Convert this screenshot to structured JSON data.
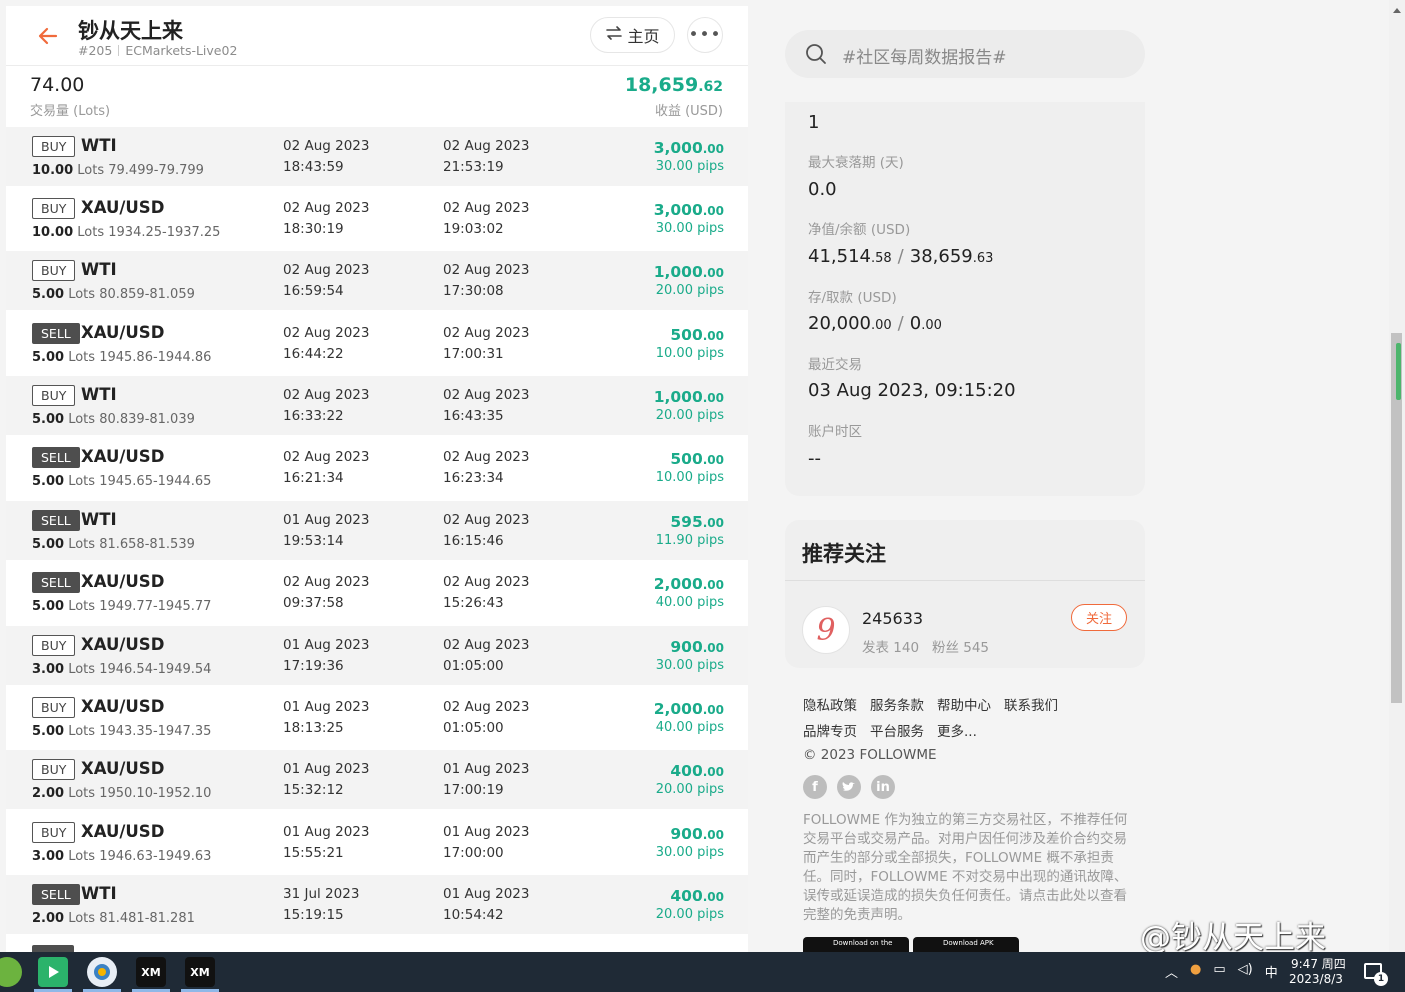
{
  "header": {
    "title": "钞从天上来",
    "rank": "#205",
    "account": "ECMarkets-Live02",
    "home_label": "主页",
    "more_label": "•••"
  },
  "summary": {
    "lots_value": "74.00",
    "lots_label": "交易量 (Lots)",
    "profit_int": "18,659",
    "profit_dec": ".62",
    "profit_label": "收益 (USD)"
  },
  "trades": [
    {
      "side": "BUY",
      "symbol": "WTI",
      "lots": "10.00",
      "lots_unit": "Lots",
      "price_range": "79.499-79.799",
      "open_date": "02 Aug 2023",
      "open_time": "18:43:59",
      "close_date": "02 Aug 2023",
      "close_time": "21:53:19",
      "pnl_int": "3,000",
      "pnl_dec": ".00",
      "pips": "30.00 pips"
    },
    {
      "side": "BUY",
      "symbol": "XAU/USD",
      "lots": "10.00",
      "lots_unit": "Lots",
      "price_range": "1934.25-1937.25",
      "open_date": "02 Aug 2023",
      "open_time": "18:30:19",
      "close_date": "02 Aug 2023",
      "close_time": "19:03:02",
      "pnl_int": "3,000",
      "pnl_dec": ".00",
      "pips": "30.00 pips"
    },
    {
      "side": "BUY",
      "symbol": "WTI",
      "lots": "5.00",
      "lots_unit": "Lots",
      "price_range": "80.859-81.059",
      "open_date": "02 Aug 2023",
      "open_time": "16:59:54",
      "close_date": "02 Aug 2023",
      "close_time": "17:30:08",
      "pnl_int": "1,000",
      "pnl_dec": ".00",
      "pips": "20.00 pips"
    },
    {
      "side": "SELL",
      "symbol": "XAU/USD",
      "lots": "5.00",
      "lots_unit": "Lots",
      "price_range": "1945.86-1944.86",
      "open_date": "02 Aug 2023",
      "open_time": "16:44:22",
      "close_date": "02 Aug 2023",
      "close_time": "17:00:31",
      "pnl_int": "500",
      "pnl_dec": ".00",
      "pips": "10.00 pips"
    },
    {
      "side": "BUY",
      "symbol": "WTI",
      "lots": "5.00",
      "lots_unit": "Lots",
      "price_range": "80.839-81.039",
      "open_date": "02 Aug 2023",
      "open_time": "16:33:22",
      "close_date": "02 Aug 2023",
      "close_time": "16:43:35",
      "pnl_int": "1,000",
      "pnl_dec": ".00",
      "pips": "20.00 pips"
    },
    {
      "side": "SELL",
      "symbol": "XAU/USD",
      "lots": "5.00",
      "lots_unit": "Lots",
      "price_range": "1945.65-1944.65",
      "open_date": "02 Aug 2023",
      "open_time": "16:21:34",
      "close_date": "02 Aug 2023",
      "close_time": "16:23:34",
      "pnl_int": "500",
      "pnl_dec": ".00",
      "pips": "10.00 pips"
    },
    {
      "side": "SELL",
      "symbol": "WTI",
      "lots": "5.00",
      "lots_unit": "Lots",
      "price_range": "81.658-81.539",
      "open_date": "01 Aug 2023",
      "open_time": "19:53:14",
      "close_date": "02 Aug 2023",
      "close_time": "16:15:46",
      "pnl_int": "595",
      "pnl_dec": ".00",
      "pips": "11.90 pips"
    },
    {
      "side": "SELL",
      "symbol": "XAU/USD",
      "lots": "5.00",
      "lots_unit": "Lots",
      "price_range": "1949.77-1945.77",
      "open_date": "02 Aug 2023",
      "open_time": "09:37:58",
      "close_date": "02 Aug 2023",
      "close_time": "15:26:43",
      "pnl_int": "2,000",
      "pnl_dec": ".00",
      "pips": "40.00 pips"
    },
    {
      "side": "BUY",
      "symbol": "XAU/USD",
      "lots": "3.00",
      "lots_unit": "Lots",
      "price_range": "1946.54-1949.54",
      "open_date": "01 Aug 2023",
      "open_time": "17:19:36",
      "close_date": "02 Aug 2023",
      "close_time": "01:05:00",
      "pnl_int": "900",
      "pnl_dec": ".00",
      "pips": "30.00 pips"
    },
    {
      "side": "BUY",
      "symbol": "XAU/USD",
      "lots": "5.00",
      "lots_unit": "Lots",
      "price_range": "1943.35-1947.35",
      "open_date": "01 Aug 2023",
      "open_time": "18:13:25",
      "close_date": "02 Aug 2023",
      "close_time": "01:05:00",
      "pnl_int": "2,000",
      "pnl_dec": ".00",
      "pips": "40.00 pips"
    },
    {
      "side": "BUY",
      "symbol": "XAU/USD",
      "lots": "2.00",
      "lots_unit": "Lots",
      "price_range": "1950.10-1952.10",
      "open_date": "01 Aug 2023",
      "open_time": "15:32:12",
      "close_date": "01 Aug 2023",
      "close_time": "17:00:19",
      "pnl_int": "400",
      "pnl_dec": ".00",
      "pips": "20.00 pips"
    },
    {
      "side": "BUY",
      "symbol": "XAU/USD",
      "lots": "3.00",
      "lots_unit": "Lots",
      "price_range": "1946.63-1949.63",
      "open_date": "01 Aug 2023",
      "open_time": "15:55:21",
      "close_date": "01 Aug 2023",
      "close_time": "17:00:00",
      "pnl_int": "900",
      "pnl_dec": ".00",
      "pips": "30.00 pips"
    },
    {
      "side": "SELL",
      "symbol": "WTI",
      "lots": "2.00",
      "lots_unit": "Lots",
      "price_range": "81.481-81.281",
      "open_date": "31 Jul 2023",
      "open_time": "15:19:15",
      "close_date": "01 Aug 2023",
      "close_time": "10:54:42",
      "pnl_int": "400",
      "pnl_dec": ".00",
      "pips": "20.00 pips"
    }
  ],
  "search": {
    "placeholder": "#社区每周数据报告#"
  },
  "stats": {
    "top_value": "1",
    "max_drawdown_label": "最大衰落期 (天)",
    "max_drawdown_value": "0.0",
    "equity_label": "净值/余额 (USD)",
    "equity_int": "41,514",
    "equity_dec": ".58",
    "balance_int": "38,659",
    "balance_dec": ".63",
    "deposit_label": "存/取款 (USD)",
    "deposit_int": "20,000",
    "deposit_dec": ".00",
    "withdraw_int": "0",
    "withdraw_dec": ".00",
    "last_trade_label": "最近交易",
    "last_trade_value": "03 Aug 2023, 09:15:20",
    "timezone_label": "账户时区",
    "timezone_value": "--"
  },
  "recommend": {
    "title": "推荐关注",
    "avatar_glyph": "9",
    "name": "245633",
    "posts_label": "发表",
    "posts": "140",
    "fans_label": "粉丝",
    "fans": "545",
    "follow_label": "关注"
  },
  "footer": {
    "links_row1": [
      "隐私政策",
      "服务条款",
      "帮助中心",
      "联系我们"
    ],
    "links_row2": [
      "品牌专页",
      "平台服务",
      "更多..."
    ],
    "copyright": "© 2023 FOLLOWME",
    "social_icons": [
      "facebook-icon",
      "twitter-icon",
      "linkedin-icon"
    ],
    "disclaimer": "FOLLOWME 作为独立的第三方交易社区，不推荐任何交易平台或交易产品。对用户因任何涉及差价合约交易而产生的部分或全部损失，FOLLOWME 概不承担责任。同时，FOLLOWME 不对交易中出现的通讯故障、误传或延误造成的损失负任何责任。请点击此处以查看完整的免责声明。",
    "appstore_label": "Download on the",
    "apk_label": "Download APK"
  },
  "watermark": "@钞从天上来",
  "taskbar": {
    "apps": [
      "xm-app",
      "xm-app"
    ],
    "app_labels": [
      "XM",
      "XM"
    ],
    "ime": "中",
    "time": "9:47 周四",
    "date": "2023/8/3",
    "notification_count": "1"
  },
  "colors": {
    "accent": "#f06a3b",
    "profit_green": "#1aab8a",
    "sell_badge": "#4e4e4e"
  }
}
